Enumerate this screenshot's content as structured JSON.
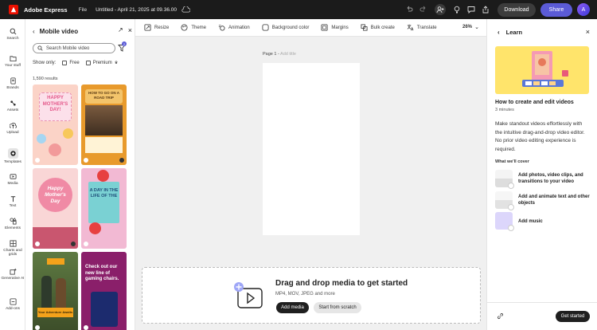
{
  "topbar": {
    "app_name": "Adobe Express",
    "file_menu": "File",
    "doc_title": "Untitled - April 21, 2025 at 09.36.00",
    "download_label": "Download",
    "share_label": "Share",
    "avatar_initial": "A"
  },
  "rail": [
    {
      "label": "Search",
      "icon": "search-icon"
    },
    {
      "label": "Your stuff",
      "icon": "folder-icon"
    },
    {
      "label": "Brands",
      "icon": "brand-icon"
    },
    {
      "label": "Assets",
      "icon": "assets-icon"
    },
    {
      "label": "Upload",
      "icon": "upload-icon"
    },
    {
      "label": "Templates",
      "icon": "templates-icon"
    },
    {
      "label": "Media",
      "icon": "media-icon"
    },
    {
      "label": "Text",
      "icon": "text-icon"
    },
    {
      "label": "Elements",
      "icon": "elements-icon"
    },
    {
      "label": "Charts and grids",
      "icon": "charts-icon"
    },
    {
      "label": "Generative AI",
      "icon": "ai-icon"
    },
    {
      "label": "Add-ons",
      "icon": "addons-icon"
    }
  ],
  "panel": {
    "title": "Mobile video",
    "search_value": "Search Mobile video",
    "filter_count": "2",
    "show_only_label": "Show only:",
    "free_label": "Free",
    "premium_label": "Premium",
    "results": "1,590 results",
    "thumbs": [
      {
        "text": "HAPPY MOTHER'S DAY!"
      },
      {
        "text": "HOW TO GO ON A ROAD TRIP"
      },
      {
        "text": "Happy Mother's Day"
      },
      {
        "text": "A DAY IN THE LIFE OF THE"
      },
      {
        "text": "Your Adventure Awaits"
      },
      {
        "text": "Check out our new line of gaming chairs."
      }
    ]
  },
  "toolbar": {
    "items": [
      "Resize",
      "Theme",
      "Animation",
      "Background color",
      "Margins",
      "Bulk create",
      "Translate"
    ],
    "zoom": "26%"
  },
  "canvas": {
    "page_label": "Page 1 -",
    "add_title": "Add title",
    "drop_title": "Drag and drop media to get started",
    "drop_sub": "MP4, MOV, JPEG and more",
    "add_media": "Add media",
    "start_scratch": "Start from scratch"
  },
  "learn": {
    "title": "Learn",
    "heading": "How to create and edit videos",
    "duration": "3 minutes",
    "description": "Make standout videos effortlessly with the intuitive drag-and-drop video editor. No prior video editing experience is required.",
    "cover_heading": "What we'll cover",
    "cover_items": [
      "Add photos, video clips, and transitions to your video",
      "Add and animate text and other objects",
      "Add music"
    ],
    "get_started": "Get started"
  },
  "colors": {
    "topbar_bg": "#1b1b1b",
    "accent": "#5b5bd6",
    "brand_red": "#eb1000"
  }
}
